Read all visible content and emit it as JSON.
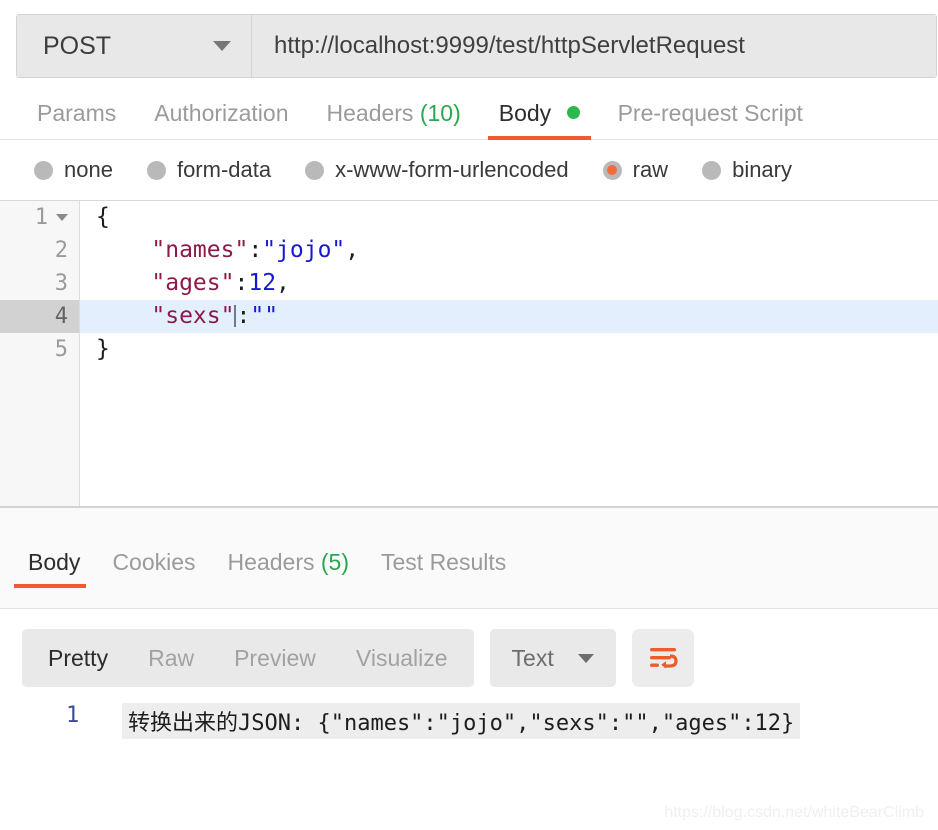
{
  "request": {
    "method": "POST",
    "method_caret": "chevron-down-icon",
    "url": "http://localhost:9999/test/httpServletRequest",
    "url_placeholder": "Enter request URL",
    "tabs": [
      {
        "label": "Params",
        "active": false
      },
      {
        "label": "Authorization",
        "active": false
      },
      {
        "label": "Headers",
        "count": "(10)",
        "active": false
      },
      {
        "label": "Body",
        "active": true,
        "dot": true
      },
      {
        "label": "Pre-request Script",
        "active": false
      }
    ],
    "body_modes": [
      {
        "label": "none",
        "checked": false
      },
      {
        "label": "form-data",
        "checked": false
      },
      {
        "label": "x-www-form-urlencoded",
        "checked": false
      },
      {
        "label": "raw",
        "checked": true
      },
      {
        "label": "binary",
        "checked": false
      }
    ],
    "editor": {
      "lines": [
        {
          "num": "1",
          "fold": true,
          "active": false,
          "text": "{"
        },
        {
          "num": "2",
          "fold": false,
          "active": false,
          "text": "    \"names\":\"jojo\","
        },
        {
          "num": "3",
          "fold": false,
          "active": false,
          "text": "    \"ages\":12,"
        },
        {
          "num": "4",
          "fold": false,
          "active": true,
          "text": "    \"sexs\":\"\""
        },
        {
          "num": "5",
          "fold": false,
          "active": false,
          "text": "}"
        }
      ],
      "line1": {
        "brace": "{"
      },
      "line2": {
        "key": "\"names\"",
        "colon": ":",
        "value": "\"jojo\"",
        "comma": ","
      },
      "line3": {
        "key": "\"ages\"",
        "colon": ":",
        "value": "12",
        "comma": ","
      },
      "line4": {
        "key": "\"sexs\"",
        "colon": ":",
        "value": "\"\""
      },
      "line5": {
        "brace": "}"
      }
    }
  },
  "response": {
    "tabs": [
      {
        "label": "Body",
        "active": true
      },
      {
        "label": "Cookies",
        "active": false
      },
      {
        "label": "Headers",
        "count": "(5)",
        "active": false
      },
      {
        "label": "Test Results",
        "active": false
      }
    ],
    "view_modes": [
      {
        "label": "Pretty",
        "active": true
      },
      {
        "label": "Raw",
        "active": false
      },
      {
        "label": "Preview",
        "active": false
      },
      {
        "label": "Visualize",
        "active": false
      }
    ],
    "format_select": {
      "value": "Text",
      "caret": "chevron-down-icon"
    },
    "wrap_button": {
      "icon": "word-wrap-icon"
    },
    "body": {
      "line_number": "1",
      "text": "转换出来的JSON: {\"names\":\"jojo\",\"sexs\":\"\",\"ages\":12}"
    }
  },
  "watermark": "https://blog.csdn.net/whiteBearClimb",
  "colors": {
    "accent_orange": "#ef5b2b",
    "status_green": "#2db84d",
    "json_key": "#8c1a4b",
    "json_value": "#1717d6",
    "active_line": "#e3effc"
  }
}
